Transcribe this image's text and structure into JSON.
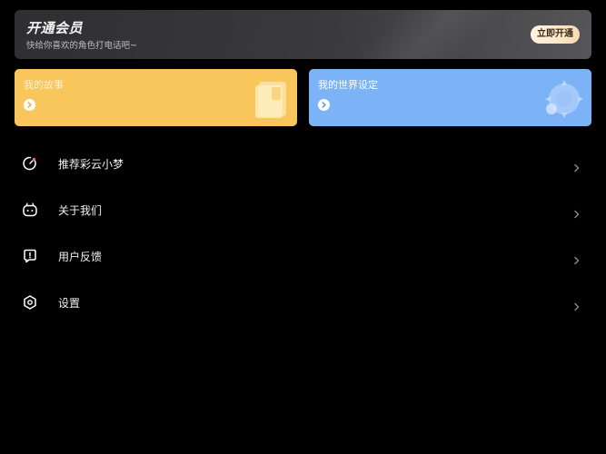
{
  "vip": {
    "title": "开通会员",
    "subtitle": "快给你喜欢的角色打电话吧~",
    "button_label": "立即开通"
  },
  "cards": {
    "story": {
      "label": "我的故事",
      "color": "#f8c65a"
    },
    "world": {
      "label": "我的世界设定",
      "color": "#7cb2f6"
    }
  },
  "menu": {
    "items": [
      {
        "label": "推荐彩云小梦",
        "icon": "recommend-icon"
      },
      {
        "label": "关于我们",
        "icon": "about-icon"
      },
      {
        "label": "用户反馈",
        "icon": "feedback-icon"
      },
      {
        "label": "设置",
        "icon": "settings-icon"
      }
    ]
  }
}
